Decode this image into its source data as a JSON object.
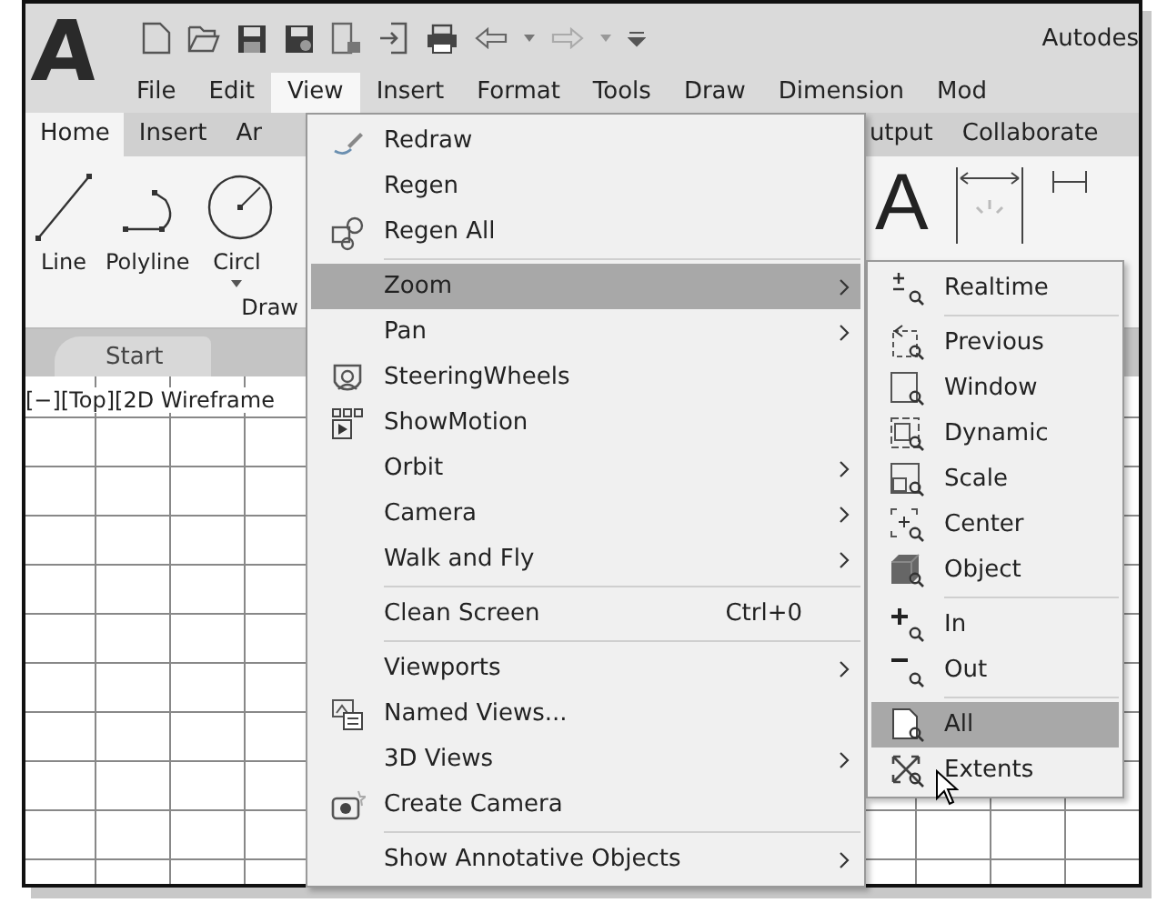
{
  "app": {
    "logo": "A",
    "title": "Autodes"
  },
  "menu_bar": [
    {
      "label": "File",
      "selected": false
    },
    {
      "label": "Edit",
      "selected": false
    },
    {
      "label": "View",
      "selected": true
    },
    {
      "label": "Insert",
      "selected": false
    },
    {
      "label": "Format",
      "selected": false
    },
    {
      "label": "Tools",
      "selected": false
    },
    {
      "label": "Draw",
      "selected": false
    },
    {
      "label": "Dimension",
      "selected": false
    },
    {
      "label": "Mod",
      "selected": false
    }
  ],
  "ribbon_tabs_left": [
    {
      "label": "Home",
      "selected": true
    },
    {
      "label": "Insert",
      "selected": false
    },
    {
      "label": "Ar",
      "selected": false
    }
  ],
  "ribbon_tabs_right": [
    {
      "label": "utput",
      "selected": false
    },
    {
      "label": "Collaborate",
      "selected": false
    }
  ],
  "draw_panel": {
    "tools": [
      {
        "label": "Line",
        "dropdown": false
      },
      {
        "label": "Polyline",
        "dropdown": false
      },
      {
        "label": "Circl",
        "dropdown": true
      }
    ],
    "label": "Draw"
  },
  "annotation_glyph": "A",
  "document_tabs": [
    {
      "label": "Start"
    }
  ],
  "viewport_label": "[−][Top][2D Wireframe",
  "view_menu": {
    "groups": [
      [
        {
          "label": "Redraw",
          "submenu": false,
          "selected": false
        },
        {
          "label": "Regen",
          "submenu": false,
          "selected": false
        },
        {
          "label": "Regen All",
          "submenu": false,
          "selected": false
        }
      ],
      [
        {
          "label": "Zoom",
          "submenu": true,
          "selected": true
        },
        {
          "label": "Pan",
          "submenu": true,
          "selected": false
        },
        {
          "label": "SteeringWheels",
          "submenu": false,
          "selected": false
        },
        {
          "label": "ShowMotion",
          "submenu": false,
          "selected": false
        },
        {
          "label": "Orbit",
          "submenu": true,
          "selected": false
        },
        {
          "label": "Camera",
          "submenu": true,
          "selected": false
        },
        {
          "label": "Walk and Fly",
          "submenu": true,
          "selected": false
        }
      ],
      [
        {
          "label": "Clean Screen",
          "submenu": false,
          "selected": false,
          "shortcut": "Ctrl+0"
        }
      ],
      [
        {
          "label": "Viewports",
          "submenu": true,
          "selected": false
        },
        {
          "label": "Named Views...",
          "submenu": false,
          "selected": false
        },
        {
          "label": "3D Views",
          "submenu": true,
          "selected": false
        },
        {
          "label": "Create Camera",
          "submenu": false,
          "selected": false
        }
      ],
      [
        {
          "label": "Show Annotative Objects",
          "submenu": true,
          "selected": false
        }
      ]
    ]
  },
  "zoom_submenu": {
    "groups": [
      [
        {
          "label": "Realtime",
          "selected": false
        }
      ],
      [
        {
          "label": "Previous",
          "selected": false
        },
        {
          "label": "Window",
          "selected": false
        },
        {
          "label": "Dynamic",
          "selected": false
        },
        {
          "label": "Scale",
          "selected": false
        },
        {
          "label": "Center",
          "selected": false
        },
        {
          "label": "Object",
          "selected": false
        }
      ],
      [
        {
          "label": "In",
          "selected": false
        },
        {
          "label": "Out",
          "selected": false
        }
      ],
      [
        {
          "label": "All",
          "selected": true
        },
        {
          "label": "Extents",
          "selected": false
        }
      ]
    ]
  }
}
